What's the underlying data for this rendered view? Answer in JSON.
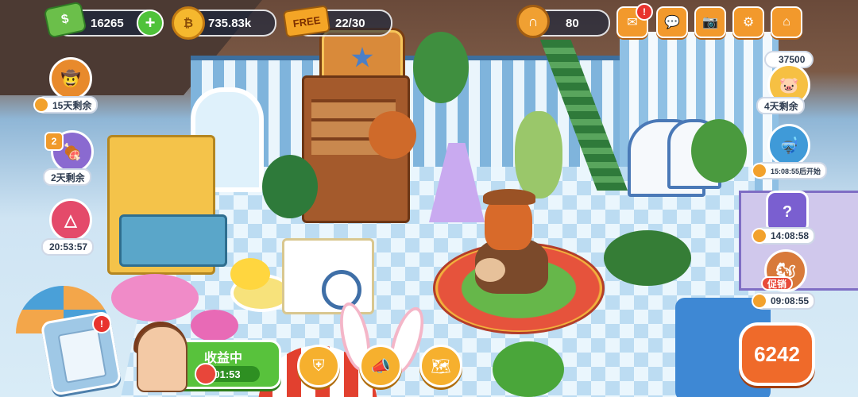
{
  "hud": {
    "cash": "16265",
    "coins": "735.83k",
    "coin_icon": "₿",
    "free_label": "FREE",
    "tickets": "22/30",
    "horseshoes": "80",
    "plus_icon": "+"
  },
  "top_right": {
    "mail_icon": "✉",
    "chat_icon": "💬",
    "camera_icon": "📷",
    "settings_icon": "⚙",
    "home_icon": "⌂",
    "mail_badge": "!"
  },
  "left_events": [
    {
      "name": "cowboy-event",
      "timer": "15天剩余"
    },
    {
      "name": "level-event",
      "level": "2",
      "timer": "2天剩余"
    },
    {
      "name": "squid-event",
      "timer": "20:53:57"
    }
  ],
  "right_events": {
    "piggy_cash": "37500",
    "piggy_timer": "4天剩余",
    "diving_timer": "15:08:55后开始",
    "mystery_timer": "14:08:58",
    "promo_label": "促销",
    "promo_timer": "09:08:55"
  },
  "bottom": {
    "task_badge": "!",
    "income_title": "收益中",
    "income_timer": "01:53",
    "score": "6242"
  },
  "colors": {
    "accent_orange": "#f2992c",
    "green": "#58c23c",
    "badge_red": "#e8332e"
  }
}
